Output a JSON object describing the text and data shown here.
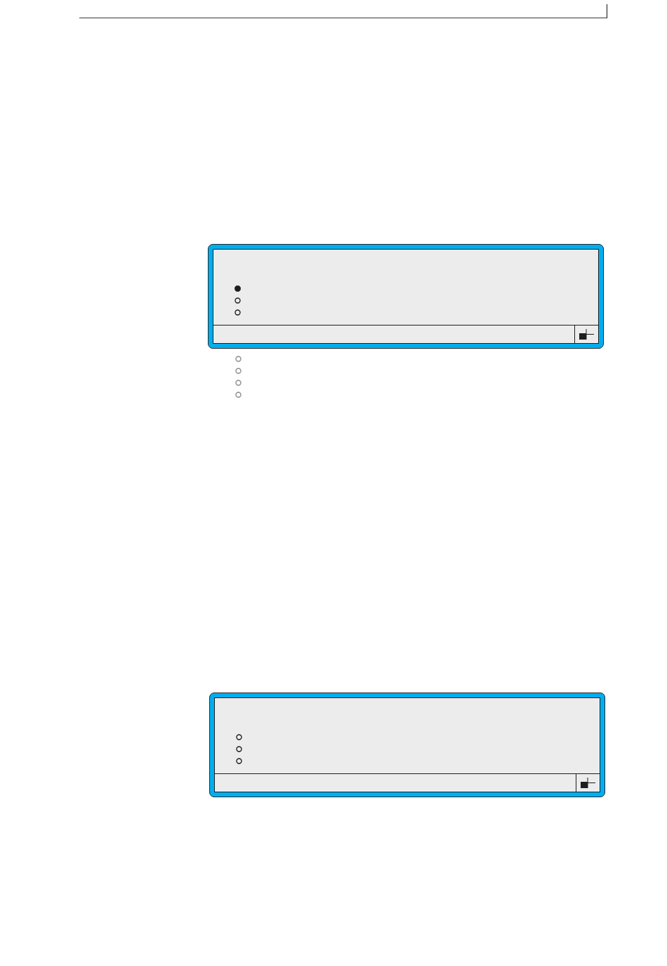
{
  "displays": [
    {
      "options": [
        {
          "selected": true,
          "disabled": false
        },
        {
          "selected": false,
          "disabled": false
        },
        {
          "selected": false,
          "disabled": false
        }
      ],
      "options_below": [
        {
          "selected": false,
          "disabled": true
        },
        {
          "selected": false,
          "disabled": true
        },
        {
          "selected": false,
          "disabled": true
        },
        {
          "selected": false,
          "disabled": true
        }
      ]
    },
    {
      "options": [
        {
          "selected": false,
          "disabled": false
        },
        {
          "selected": false,
          "disabled": false
        },
        {
          "selected": false,
          "disabled": false
        }
      ]
    }
  ]
}
